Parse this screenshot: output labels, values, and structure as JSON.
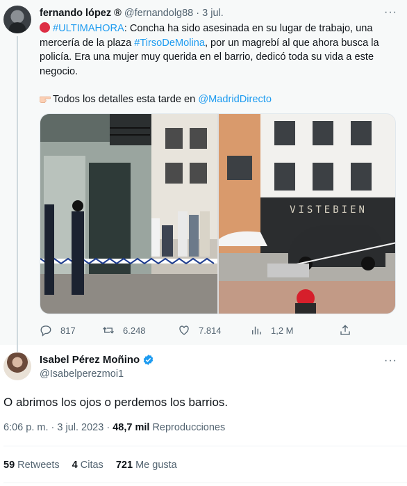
{
  "parent_tweet": {
    "author_name": "fernando lópez ®",
    "handle": "@fernandolg88",
    "separator": "·",
    "date": "3 jul.",
    "text_lead": "#ULTIMAHORA",
    "text_part1": ": Concha ha sido asesinada en su lugar de trabajo, una mercería de la plaza ",
    "text_hashtag2": "#TirsoDeMolina",
    "text_part2": ", por un magrebí al que ahora busca la policía. Era una mujer muy querida en el barrio, dedicó toda su vida a este negocio.",
    "text_details": "Todos los detalles esta tarde en ",
    "text_mention": "@MadridDirecto",
    "shop_sign": "VISTEBIEN",
    "actions": {
      "replies": "817",
      "retweets": "6.248",
      "likes": "7.814",
      "views": "1,2 M"
    }
  },
  "main_tweet": {
    "author_name": "Isabel Pérez Moñino",
    "handle": "@Isabelperezmoi1",
    "text": "O abrimos los ojos o perdemos los barrios.",
    "time": "6:06 p. m.",
    "separator": "·",
    "date": "3 jul. 2023",
    "views_count": "48,7 mil",
    "views_label": "Reproducciones",
    "stats": {
      "retweets_count": "59",
      "retweets_label": "Retweets",
      "quotes_count": "4",
      "quotes_label": "Citas",
      "likes_count": "721",
      "likes_label": "Me gusta"
    }
  },
  "colors": {
    "link": "#1d9bf0",
    "secondary_text": "#536471",
    "verified": "#1d9bf0"
  }
}
